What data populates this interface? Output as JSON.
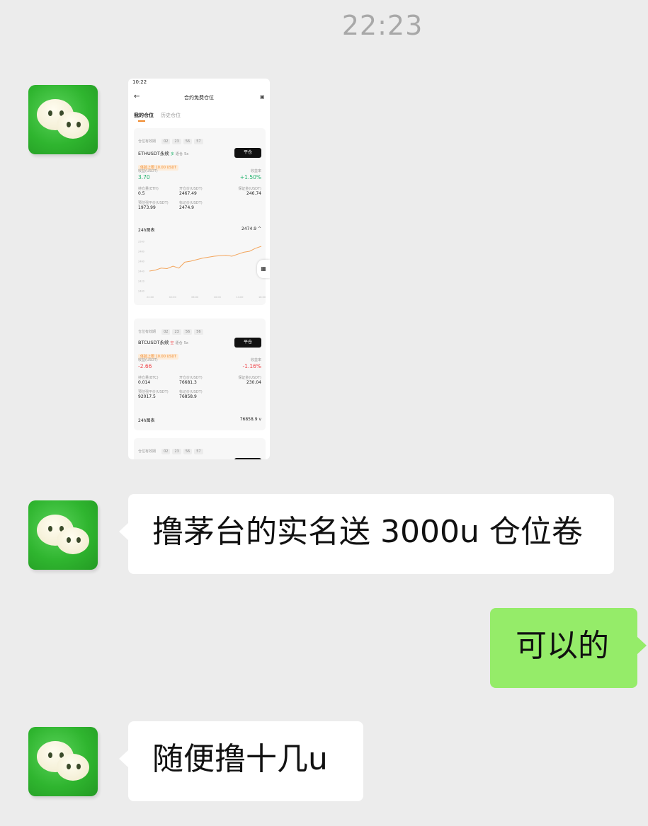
{
  "chat": {
    "time": "22:23",
    "messages": [
      {
        "from": "other",
        "type": "image"
      },
      {
        "from": "other",
        "type": "text",
        "text": "撸茅台的实名送 3000u 仓位卷"
      },
      {
        "from": "me",
        "type": "text",
        "text": "可以的"
      },
      {
        "from": "other",
        "type": "text",
        "text": "随便撸十几u"
      }
    ]
  },
  "shot": {
    "status_time": "10:22",
    "title": "合约免费仓位",
    "tabs": [
      "我的仓位",
      "历史仓位"
    ],
    "cards": [
      {
        "expiry_label": "仓位有效期",
        "countdown": [
          "02",
          "23",
          "56",
          "57"
        ],
        "symbol": "ETHUSDT永续",
        "side": "多",
        "mode": "逐仓",
        "leverage": "5x",
        "tag": "体验上限 10.00 USDT",
        "close_label": "平仓",
        "pnl_label": "收益(USDT)",
        "pnl": "3.70",
        "roe_label": "收益率",
        "roe": "+1.50%",
        "qty_label": "持仓量(ETH)",
        "qty": "0.5",
        "entry_label": "开仓价(USDT)",
        "entry": "2467.49",
        "margin_label": "保证金(USDT)",
        "margin": "246.74",
        "liq_label": "预估强平价(USDT)",
        "liq": "1973.99",
        "mark_label": "标记价(USDT)",
        "mark": "2474.9",
        "chart_label": "24h图表",
        "chart_value": "2474.9",
        "chart_arrow": "^",
        "chart_y_ticks": [
          "2500",
          "2480",
          "2460",
          "2440",
          "2420",
          "2400"
        ],
        "chart_x_ticks": [
          "22:00",
          "02:00",
          "06:00",
          "10:00",
          "14:00",
          "18:00"
        ],
        "price_series": [
          2440,
          2442,
          2446,
          2445,
          2450,
          2446,
          2458,
          2460,
          2463,
          2466,
          2468,
          2470,
          2471,
          2472,
          2470,
          2474,
          2478,
          2480,
          2486,
          2490
        ]
      },
      {
        "expiry_label": "仓位有效期",
        "countdown": [
          "02",
          "23",
          "56",
          "56"
        ],
        "symbol": "BTCUSDT永续",
        "side": "空",
        "mode": "逐仓",
        "leverage": "5x",
        "tag": "体验上限 10.00 USDT",
        "close_label": "平仓",
        "pnl_label": "收益(USDT)",
        "pnl": "-2.66",
        "roe_label": "收益率",
        "roe": "-1.16%",
        "qty_label": "持仓量(BTC)",
        "qty": "0.014",
        "entry_label": "开仓价(USDT)",
        "entry": "76681.3",
        "margin_label": "保证金(USDT)",
        "margin": "230.04",
        "liq_label": "预估强平价(USDT)",
        "liq": "92017.5",
        "mark_label": "标记价(USDT)",
        "mark": "76858.9",
        "chart_label": "24h图表",
        "chart_value": "76858.9",
        "chart_arrow": "v"
      },
      {
        "expiry_label": "仓位有效期",
        "countdown": [
          "02",
          "23",
          "56",
          "57"
        ]
      }
    ],
    "colors": {
      "up": "#20b26c",
      "down": "#ef454a",
      "line": "#f3a55c"
    }
  }
}
